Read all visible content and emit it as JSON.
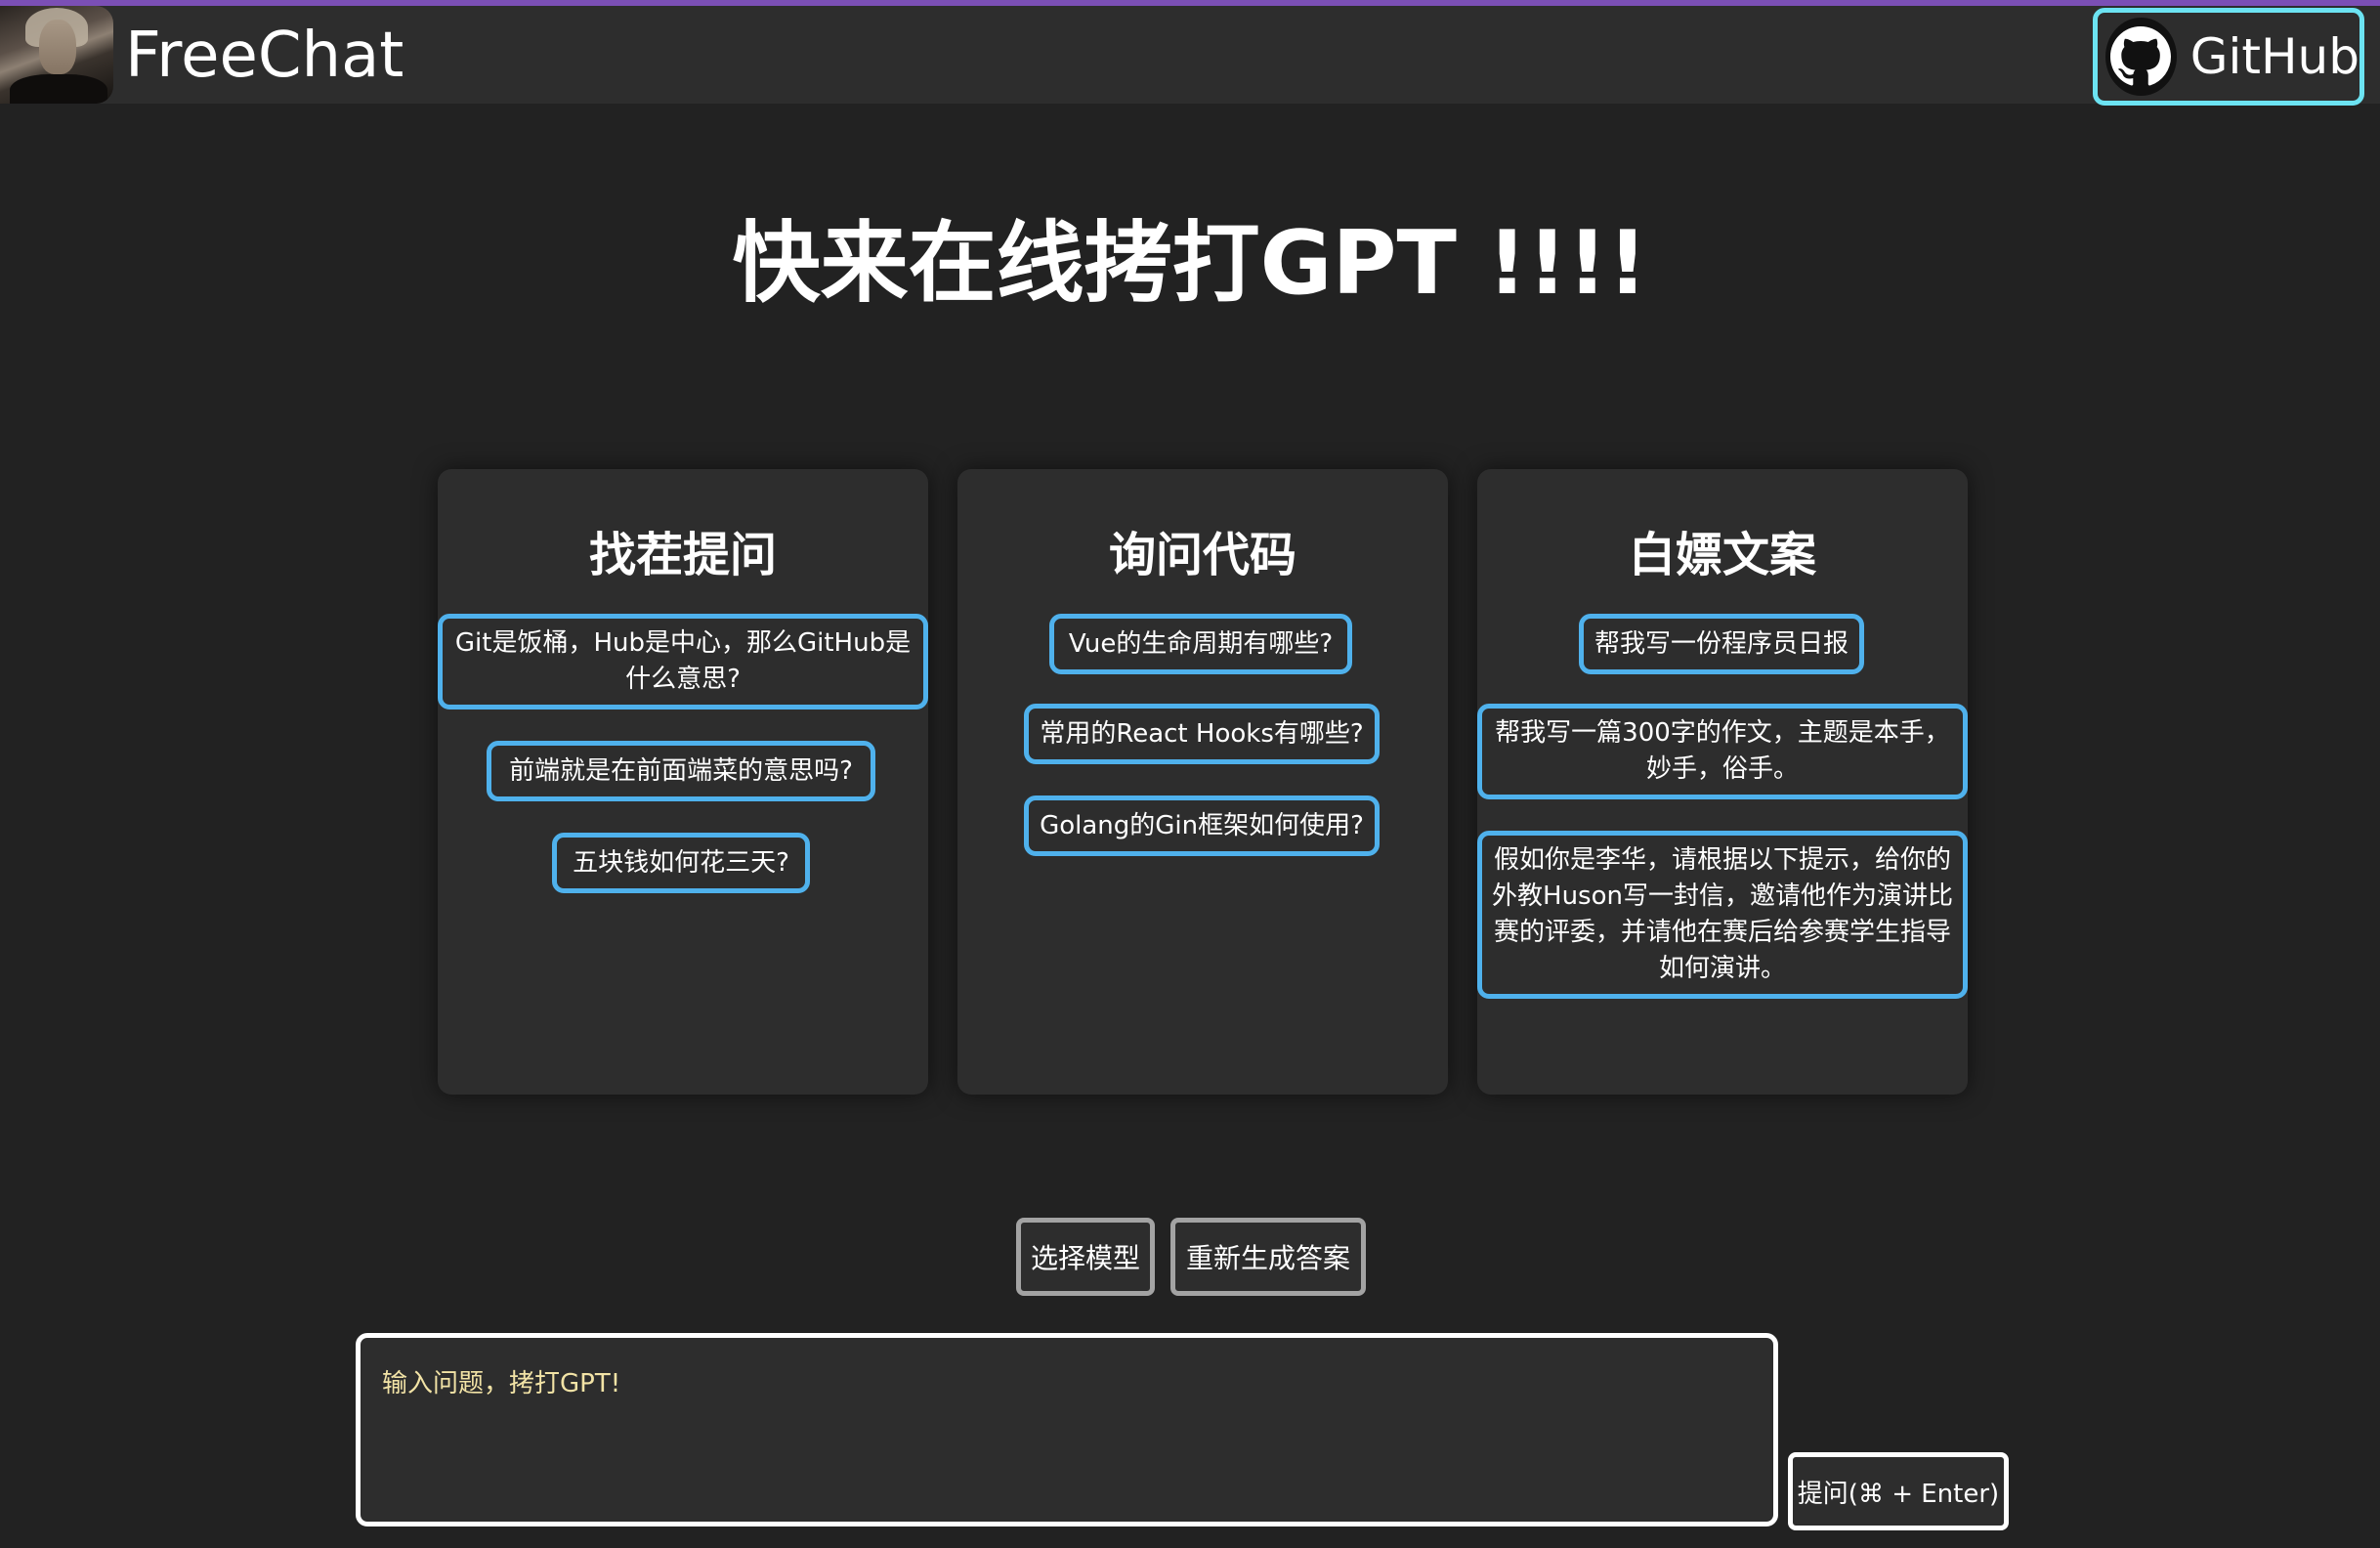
{
  "header": {
    "brand": "FreeChat",
    "github_label": "GitHub"
  },
  "hero": {
    "title": "快来在线拷打GPT !!!!"
  },
  "cards": [
    {
      "title": "找茬提问",
      "prompts": [
        "Git是饭桶，Hub是中心，那么GitHub是什么意思?",
        "前端就是在前面端菜的意思吗?",
        "五块钱如何花三天?"
      ]
    },
    {
      "title": "询问代码",
      "prompts": [
        "Vue的生命周期有哪些?",
        "常用的React Hooks有哪些?",
        "Golang的Gin框架如何使用?"
      ]
    },
    {
      "title": "白嫖文案",
      "prompts": [
        "帮我写一份程序员日报",
        "帮我写一篇300字的作文，主题是本手，妙手，俗手。",
        "假如你是李华，请根据以下提示，给你的外教Huson写一封信，邀请他作为演讲比赛的评委，并请他在赛后给参赛学生指导如何演讲。"
      ]
    }
  ],
  "controls": {
    "select_model": "选择模型",
    "regenerate": "重新生成答案"
  },
  "input": {
    "placeholder": "输入问题，拷打GPT!",
    "value": ""
  },
  "submit": {
    "label": "提问(⌘ + Enter)"
  },
  "colors": {
    "background": "#222222",
    "panel": "#2d2d2d",
    "chip_border": "#4fb1ec",
    "github_border": "#6ce3f2",
    "placeholder": "#f2e3a6",
    "top_accent": "#7b4fb5"
  }
}
